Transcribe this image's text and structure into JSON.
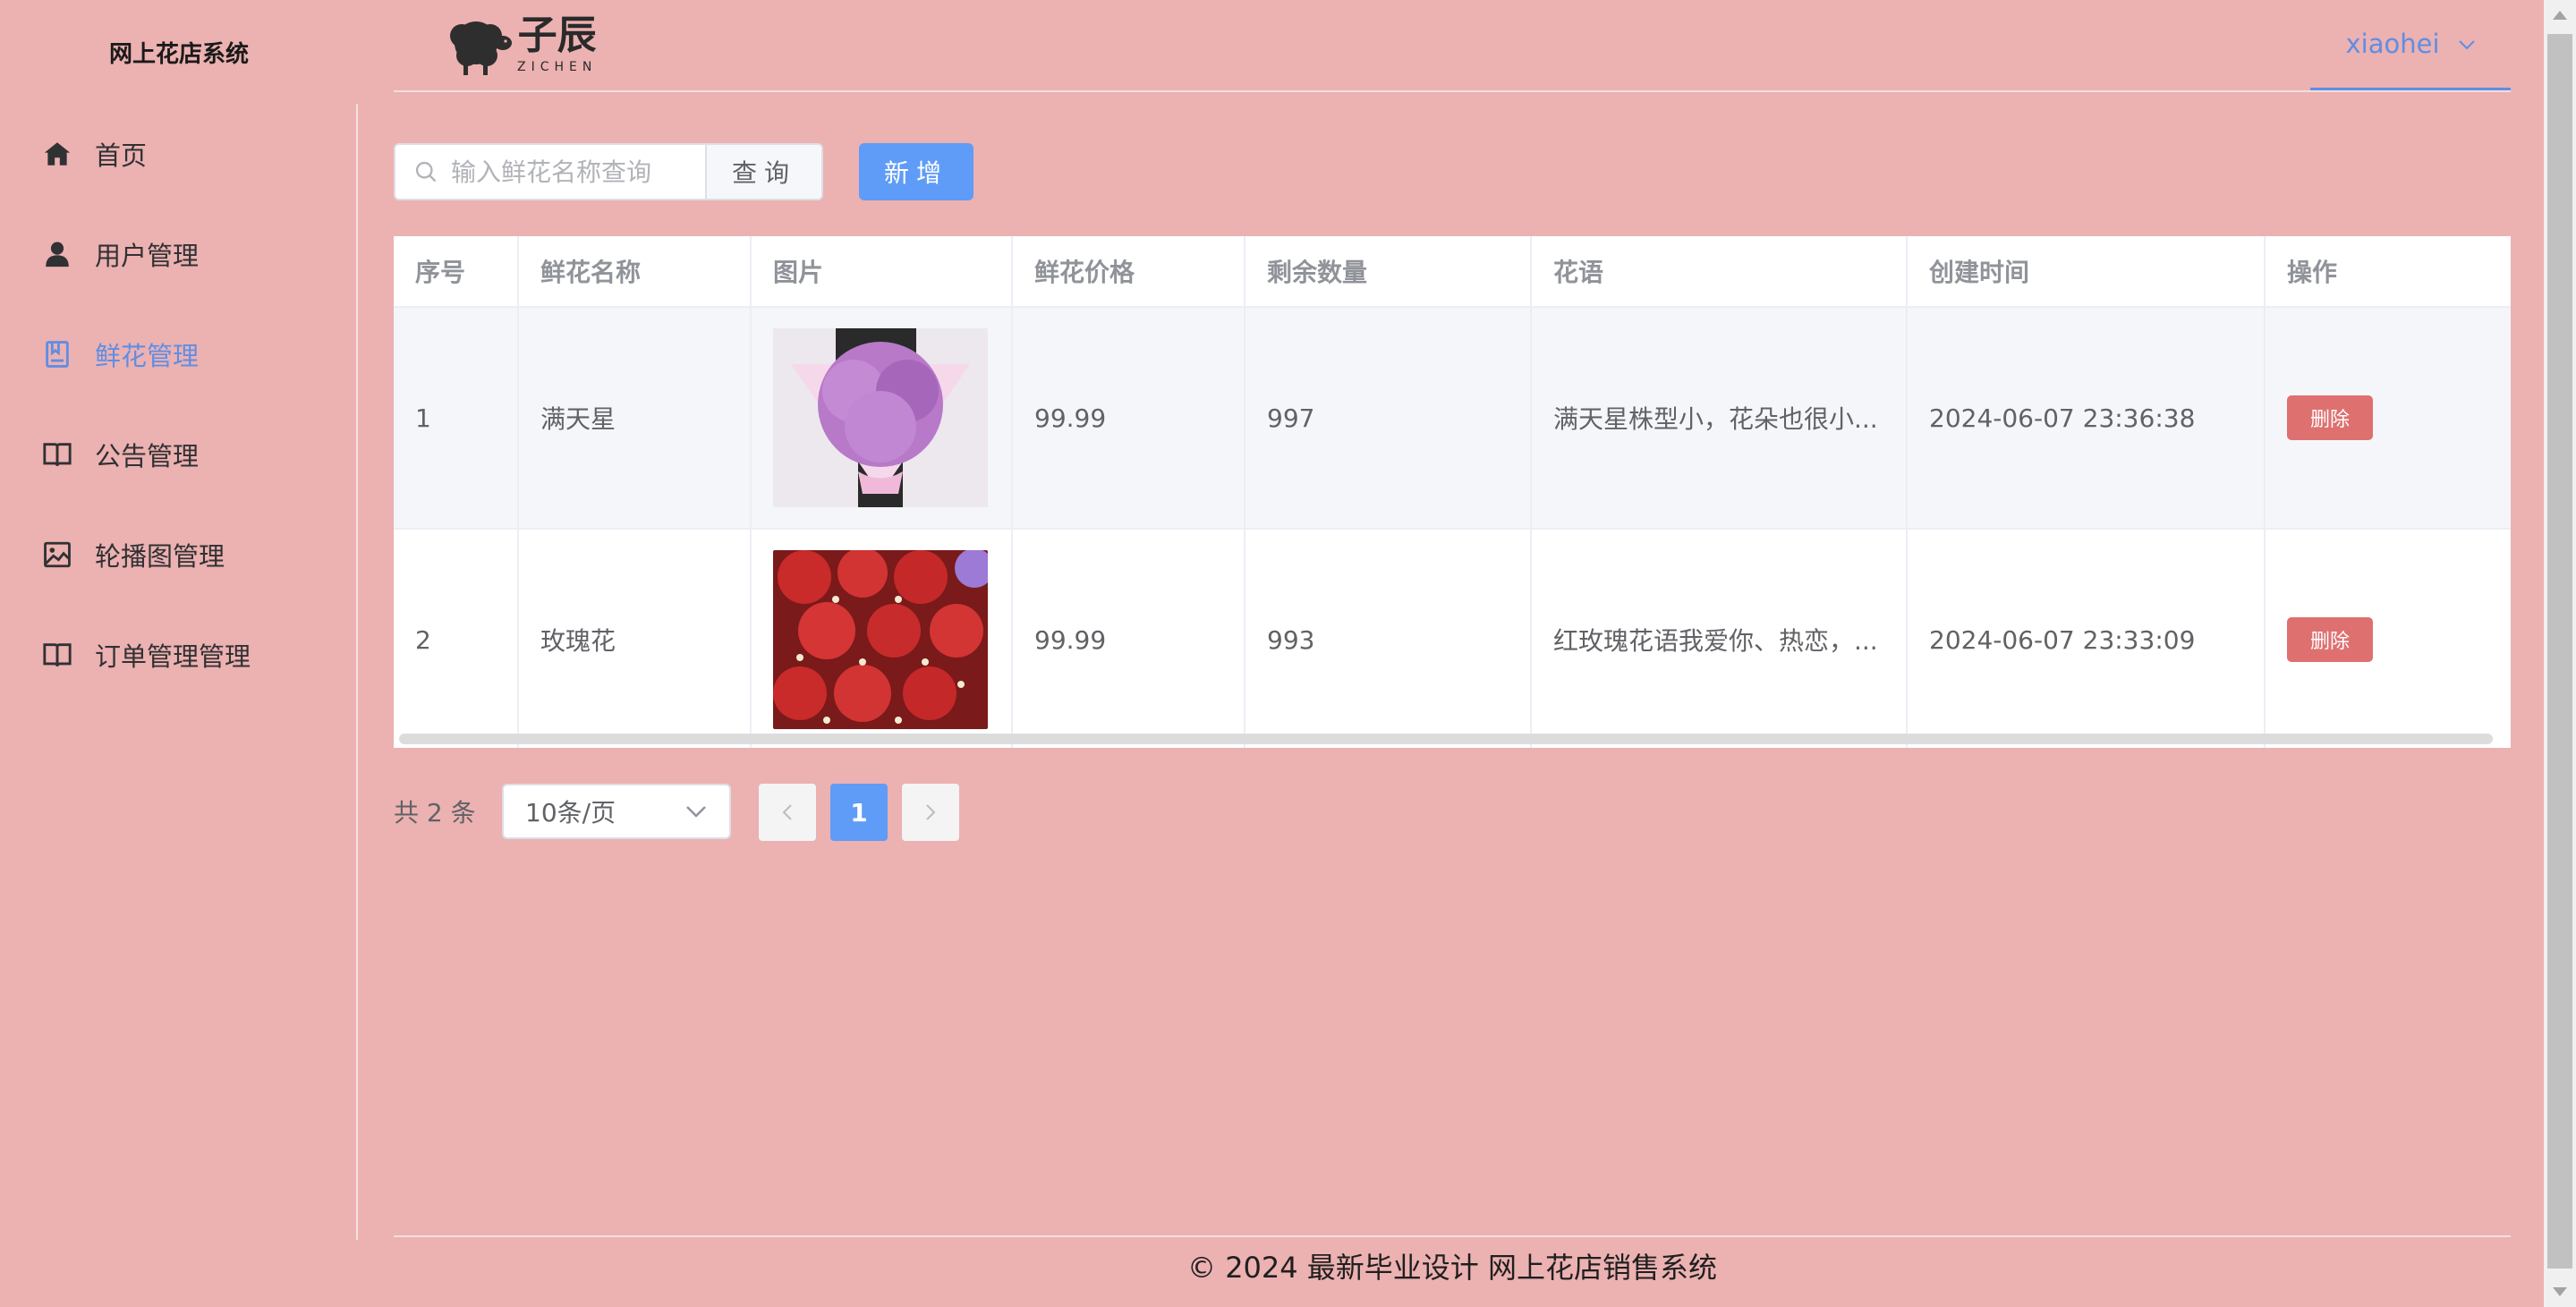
{
  "app": {
    "title": "网上花店系统"
  },
  "logo": {
    "cn": "子辰",
    "en": "ZICHEN"
  },
  "user": {
    "name": "xiaohei"
  },
  "sidebar": {
    "items": [
      {
        "label": "首页",
        "icon": "home-icon"
      },
      {
        "label": "用户管理",
        "icon": "user-icon"
      },
      {
        "label": "鲜花管理",
        "icon": "notebook-icon",
        "active": true
      },
      {
        "label": "公告管理",
        "icon": "book-icon"
      },
      {
        "label": "轮播图管理",
        "icon": "picture-icon"
      },
      {
        "label": "订单管理管理",
        "icon": "book-icon"
      }
    ]
  },
  "toolbar": {
    "search_placeholder": "输入鲜花名称查询",
    "search_value": "",
    "search_label": "查询",
    "add_label": "新增"
  },
  "table": {
    "columns": [
      "序号",
      "鲜花名称",
      "图片",
      "鲜花价格",
      "剩余数量",
      "花语",
      "创建时间",
      "操作"
    ],
    "rows": [
      {
        "index": "1",
        "name": "满天星",
        "image": "gypsophila bouquet",
        "price": "99.99",
        "stock": "997",
        "meaning": "满天星株型小，花朵也很小...",
        "created": "2024-06-07 23:36:38",
        "action": "删除"
      },
      {
        "index": "2",
        "name": "玫瑰花",
        "image": "red roses",
        "price": "99.99",
        "stock": "993",
        "meaning": "红玫瑰花语我爱你、热恋，...",
        "created": "2024-06-07 23:33:09",
        "action": "删除"
      }
    ]
  },
  "pagination": {
    "total": "共 2 条",
    "page_size": "10条/页",
    "current_page": "1"
  },
  "footer": {
    "text": "© 2024 最新毕业设计 网上花店销售系统"
  },
  "colors": {
    "background": "#ecb1b1",
    "accent": "#5f9cf7",
    "danger": "#df7070"
  }
}
